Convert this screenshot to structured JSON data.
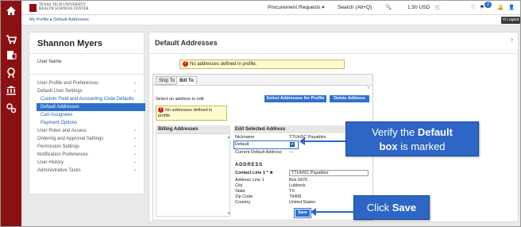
{
  "rail": {
    "icons": [
      "home-icon",
      "cart-icon",
      "requisitions-icon",
      "orders-icon",
      "accounts-payable-icon",
      "settings-icon"
    ]
  },
  "topbar": {
    "logo_line1": "TEXAS TECH UNIVERSITY",
    "logo_line2": "HEALTH SCIENCES CENTER",
    "procurement": "Procurement Requests ▾",
    "search": "Search (Alt+Q)",
    "search_icon": "🔍",
    "currency": "1.50 USD",
    "cart_icon": "🛒",
    "heart_icon": "♡",
    "flag_icon": "⚑",
    "notification_count": "2",
    "bell_icon": "🔔",
    "user_icon": "👤"
  },
  "breadcrumb": {
    "path": "My Profile ▸ Default Addresses",
    "logout": "⟲ Logout"
  },
  "sidebar": {
    "name": "Shannon Myers",
    "user_name": "User Name",
    "items": [
      {
        "label": "User Profile and Preferences",
        "chev": "›"
      },
      {
        "label": "Default User Settings",
        "chev": "‹"
      },
      {
        "label": "Custom Field and Accounting Code Defaults"
      },
      {
        "label": "Default Addresses"
      },
      {
        "label": "Cart Assignees"
      },
      {
        "label": "Payment Options"
      },
      {
        "label": "User Roles and Access",
        "chev": "›"
      },
      {
        "label": "Ordering and Approval Settings",
        "chev": "›"
      },
      {
        "label": "Permission Settings",
        "chev": "›"
      },
      {
        "label": "Notification Preferences",
        "chev": "›"
      },
      {
        "label": "User History",
        "chev": "›"
      },
      {
        "label": "Administrative Tasks",
        "chev": "›"
      }
    ]
  },
  "main": {
    "title": "Default Addresses",
    "help": "?",
    "warning": "No addresses defined in profile.",
    "tabs": [
      "Ship To",
      "Bill To"
    ],
    "select_label": "Select an address to edit",
    "select_button": "Select Addresses for Profile",
    "delete_button": "Delete Address",
    "inner_help": "?",
    "inner_warning": "No addresses defined in profile.",
    "billing_header": "Billing Addresses",
    "edit_header": "Edit Selected Address",
    "fields": {
      "nickname_label": "Nickname",
      "nickname_value": "TTUHSC Payables",
      "default_label": "Default",
      "default_checked": "✔",
      "current_default_label": "Current Default Address",
      "current_default_value": "---",
      "address_header": "ADDRESS",
      "contact_label": "Contact Line 1 * ★",
      "contact_value": "TTUHSC Payables",
      "address1_label": "Address Line 1",
      "address1_value": "Box 5970",
      "city_label": "City",
      "city_value": "Lubbock",
      "state_label": "State",
      "state_value": "TX",
      "zip_label": "Zip Code",
      "zip_value": "79408",
      "country_label": "Country",
      "country_value": "United States"
    },
    "save_button": "Save"
  },
  "callouts": {
    "default_pre": "Verify the ",
    "default_bold1": "Default",
    "default_bold2": "box",
    "default_post": " is marked",
    "save_pre": "Click ",
    "save_bold": "Save"
  },
  "colors": {
    "rail": "#8b1014",
    "accent": "#2f70c9",
    "callout": "#2d66c4",
    "warning_bg": "#fffbd0"
  }
}
